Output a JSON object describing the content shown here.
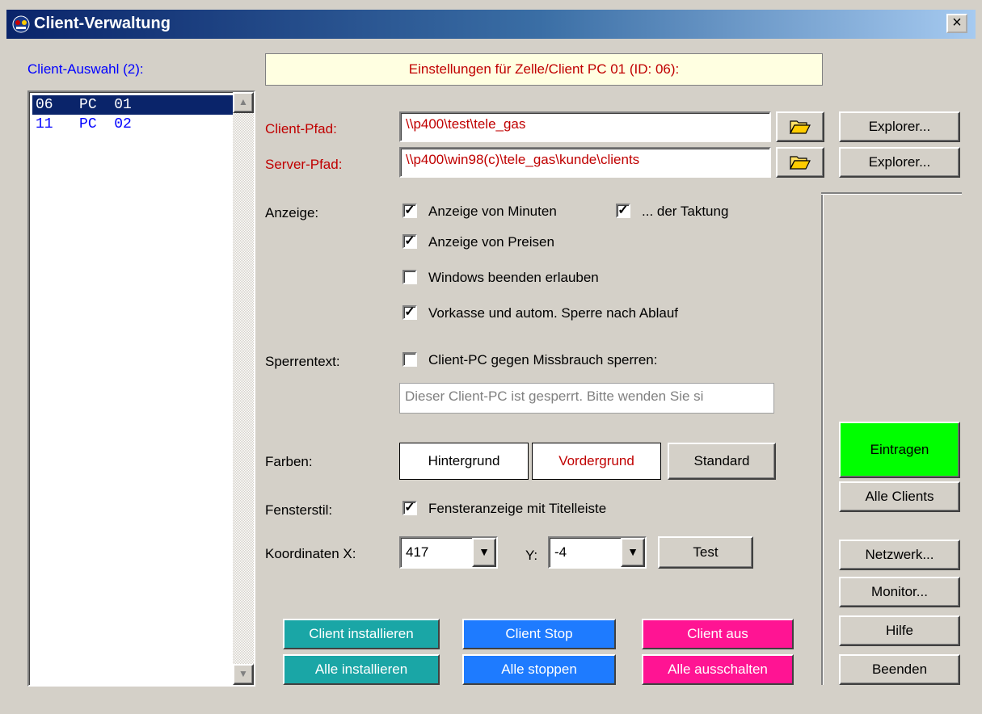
{
  "window": {
    "title": "Client-Verwaltung",
    "close": "×"
  },
  "client_list": {
    "label": "Client-Auswahl (2):",
    "items": [
      {
        "id": "06",
        "name": "PC  01",
        "selected": true
      },
      {
        "id": "11",
        "name": "PC  02",
        "selected": false
      }
    ]
  },
  "header": {
    "text": "Einstellungen für Zelle/Client PC 01 (ID: 06):"
  },
  "paths": {
    "client_label": "Client-Pfad:",
    "client_value": "\\\\p400\\test\\tele_gas",
    "server_label": "Server-Pfad:",
    "server_value": "\\\\p400\\win98(c)\\tele_gas\\kunde\\clients",
    "explorer": "Explorer..."
  },
  "anzeige": {
    "label": "Anzeige:",
    "minuten": "Anzeige von Minuten",
    "taktung": "... der Taktung",
    "preisen": "Anzeige von Preisen",
    "windows": "Windows beenden erlauben",
    "vorkasse": "Vorkasse und autom. Sperre nach Ablauf"
  },
  "sperre": {
    "label": "Sperrentext:",
    "check": "Client-PC gegen Missbrauch sperren:",
    "text": "Dieser Client-PC ist gesperrt. Bitte wenden Sie si"
  },
  "farben": {
    "label": "Farben:",
    "hintergrund": "Hintergrund",
    "vordergrund": "Vordergrund",
    "standard": "Standard"
  },
  "fenster": {
    "label": "Fensterstil:",
    "check": "Fensteranzeige mit Titelleiste"
  },
  "koord": {
    "label": "Koordinaten X:",
    "x": "417",
    "ylabel": "Y:",
    "y": "-4",
    "test": "Test"
  },
  "actions": {
    "installieren": "Client installieren",
    "alle_installieren": "Alle installieren",
    "stop": "Client Stop",
    "alle_stoppen": "Alle stoppen",
    "aus": "Client aus",
    "alle_aus": "Alle ausschalten"
  },
  "side": {
    "eintragen": "Eintragen",
    "alle_clients": "Alle Clients",
    "netzwerk": "Netzwerk...",
    "monitor": "Monitor...",
    "hilfe": "Hilfe",
    "beenden": "Beenden"
  },
  "colors": {
    "teal": "#1aa6a6",
    "blue": "#1e7bff",
    "magenta": "#ff1493",
    "green": "#00ff00",
    "header_bg": "#ffffe1"
  }
}
